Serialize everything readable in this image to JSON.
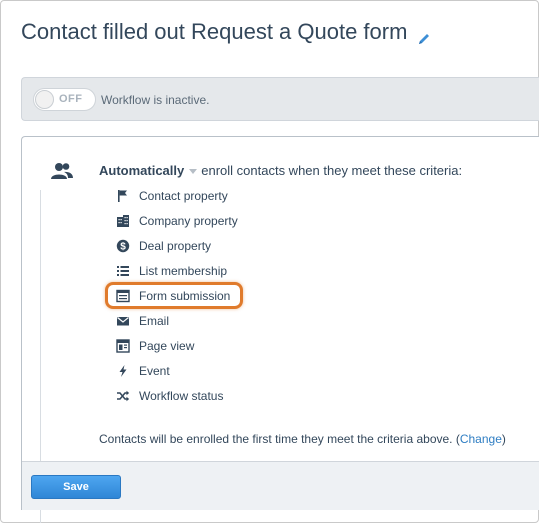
{
  "header": {
    "title": "Contact filled out Request a Quote form"
  },
  "status": {
    "toggle_label": "OFF",
    "message": "Workflow is inactive."
  },
  "enrollment": {
    "mode": "Automatically",
    "criteria_text": "enroll contacts when they meet these criteria:",
    "options": [
      {
        "label": "Contact property",
        "icon": "flag-icon"
      },
      {
        "label": "Company property",
        "icon": "building-icon"
      },
      {
        "label": "Deal property",
        "icon": "dollar-icon"
      },
      {
        "label": "List membership",
        "icon": "list-icon"
      },
      {
        "label": "Form submission",
        "icon": "form-icon"
      },
      {
        "label": "Email",
        "icon": "envelope-icon"
      },
      {
        "label": "Page view",
        "icon": "page-icon"
      },
      {
        "label": "Event",
        "icon": "bolt-icon"
      },
      {
        "label": "Workflow status",
        "icon": "shuffle-icon"
      }
    ],
    "note_text": "Contacts will be enrolled the first time they meet the criteria above. (",
    "note_link": "Change",
    "note_close": ")"
  },
  "footer": {
    "save_label": "Save"
  },
  "colors": {
    "accent": "#2f86d6",
    "highlight": "#e07b2c",
    "link": "#2f7ec3"
  }
}
